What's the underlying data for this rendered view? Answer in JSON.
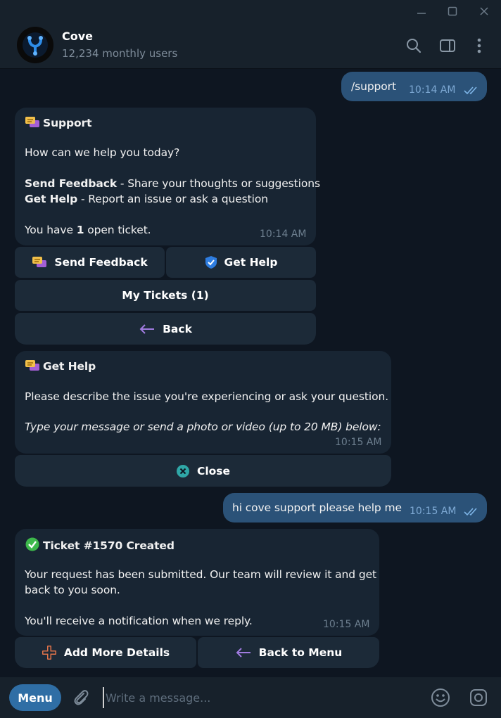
{
  "window": {
    "minimize_icon": "minimize-icon",
    "maximize_icon": "maximize-icon",
    "close_icon": "close-icon"
  },
  "header": {
    "title": "Cove",
    "subtitle": "12,234 monthly users",
    "avatar_icon": "cove-logo-icon"
  },
  "messages": [
    {
      "type": "out",
      "text": "/support",
      "time": "10:14 AM",
      "status": "read"
    },
    {
      "type": "in",
      "title": "Support",
      "intro": "How can we help you today?",
      "line1_bold": "Send Feedback",
      "line1_rest": " - Share your thoughts or suggestions",
      "line2_bold": "Get Help",
      "line2_rest": " - Report an issue or ask a question",
      "tickets_pre": "You have ",
      "tickets_count": "1",
      "tickets_post": " open ticket.",
      "time": "10:14 AM",
      "buttons": {
        "send_feedback": "Send Feedback",
        "get_help": "Get Help",
        "my_tickets": "My Tickets (1)",
        "back": "Back"
      }
    },
    {
      "type": "in",
      "title": "Get Help",
      "body": "Please describe the issue you're experiencing or ask your question.",
      "hint": "Type your message or send a photo or video (up to 20 MB) below:",
      "time": "10:15 AM",
      "buttons": {
        "close": "Close"
      }
    },
    {
      "type": "out",
      "text": "hi cove support please help me",
      "time": "10:15 AM",
      "status": "read"
    },
    {
      "type": "in",
      "title": "Ticket #1570 Created",
      "body_line1": "Your request has been submitted. Our team will review it and get",
      "body_line2": "back to you soon.",
      "body_line3": "You'll receive a notification when we reply.",
      "time": "10:15 AM",
      "buttons": {
        "add_details": "Add More Details",
        "back_to_menu": "Back to Menu"
      }
    }
  ],
  "composer": {
    "menu_label": "Menu",
    "placeholder": "Write a message..."
  },
  "colors": {
    "background": "#0e1621",
    "header": "#17212b",
    "incoming_bubble": "#182533",
    "outgoing_bubble": "#2b5278",
    "keyboard_button": "#1c2a38",
    "menu_button": "#2f6ea5"
  }
}
